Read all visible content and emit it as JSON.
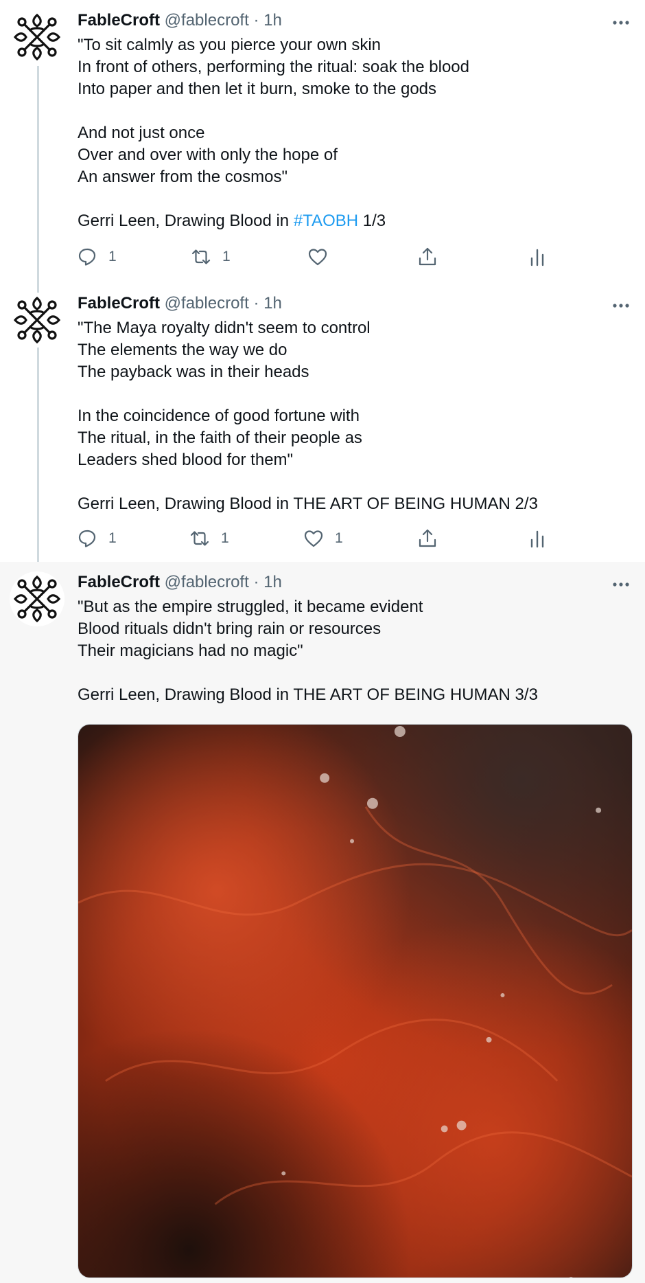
{
  "tweets": [
    {
      "author": {
        "name": "FableCroft",
        "handle": "@fablecroft",
        "separator": "·",
        "time": "1h",
        "avatar_icon": "knotwork-logo-icon"
      },
      "text_before": "\"To sit calmly as you pierce your own skin\nIn front of others, performing the ritual: soak the blood\nInto paper and then let it burn, smoke to the gods\n\nAnd not just once\nOver and over with only the hope of\nAn answer from the cosmos\"\n\nGerri Leen, Drawing Blood in ",
      "hashtag": "#TAOBH",
      "text_after": " 1/3",
      "actions": {
        "reply": "1",
        "retweet": "1",
        "like": "",
        "share": "",
        "analytics": ""
      }
    },
    {
      "author": {
        "name": "FableCroft",
        "handle": "@fablecroft",
        "separator": "·",
        "time": "1h",
        "avatar_icon": "knotwork-logo-icon"
      },
      "text": "\"The Maya royalty didn't seem to control\nThe elements the way we do\nThe payback was in their heads\n\nIn the coincidence of good fortune with\nThe ritual, in the faith of their people as\nLeaders shed blood for them\"\n\nGerri Leen, Drawing Blood in THE ART OF BEING HUMAN 2/3",
      "actions": {
        "reply": "1",
        "retweet": "1",
        "like": "1",
        "share": "",
        "analytics": ""
      }
    },
    {
      "author": {
        "name": "FableCroft",
        "handle": "@fablecroft",
        "separator": "·",
        "time": "1h",
        "avatar_icon": "knotwork-logo-icon"
      },
      "text": "\"But as the empire struggled, it became evident\nBlood rituals didn't bring rain or resources\nTheir magicians had no magic\"\n\nGerri Leen, Drawing Blood in THE ART OF BEING HUMAN 3/3",
      "media": {
        "type": "photo",
        "colors": {
          "base": "#2a1a14",
          "primary": "#c93a14",
          "accent": "#e0522a"
        }
      }
    }
  ],
  "colors": {
    "hashtag": "#1d9bf0",
    "secondary_text": "#536471",
    "thread_line": "#cfd9de",
    "highlight_bg": "#f7f7f7"
  }
}
